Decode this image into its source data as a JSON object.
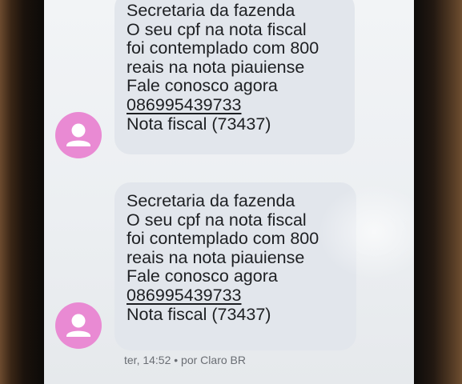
{
  "colors": {
    "avatar": "#e98ad3",
    "bubble": "#e2e6ec",
    "screen": "#eef1f4",
    "text": "#1d1f22",
    "meta_text": "#6a6e74"
  },
  "messages": [
    {
      "lines": [
        "Secretaria da fazenda",
        "O seu cpf na nota fiscal",
        "foi contemplado com 800",
        "reais na nota piauiense",
        "Fale conosco agora"
      ],
      "phone": "086995439733",
      "footer": "Nota fiscal (73437)",
      "avatar_icon": "person-icon"
    },
    {
      "lines": [
        "Secretaria da fazenda",
        "O seu cpf na nota fiscal",
        "foi contemplado com 800",
        "reais na nota piauiense",
        "Fale conosco agora"
      ],
      "phone": "086995439733",
      "footer": "Nota fiscal (73437)",
      "avatar_icon": "person-icon"
    }
  ],
  "meta": {
    "timestamp_line": "ter, 14:52 • por Claro BR"
  }
}
